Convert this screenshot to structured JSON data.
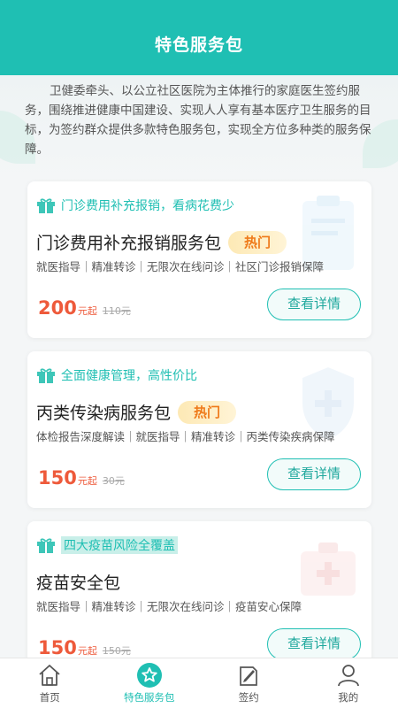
{
  "header": {
    "title": "特色服务包"
  },
  "intro": "卫健委牵头、以公立社区医院为主体推行的家庭医生签约服务，围绕推进健康中国建设、实现人人享有基本医疗卫生服务的目标，为签约群众提供多款特色服务包，实现全方位多种类的服务保障。",
  "packages": [
    {
      "tag": "门诊费用补充报销，看病花费少",
      "title": "门诊费用补充报销服务包",
      "hot": "热门",
      "services": "就医指导｜精准转诊｜无限次在线问诊｜社区门诊报销保障",
      "price": "200",
      "unit": "元起",
      "original": "110元",
      "button": "查看详情"
    },
    {
      "tag": "全面健康管理，高性价比",
      "title": "丙类传染病服务包",
      "hot": "热门",
      "services": "体检报告深度解读｜就医指导｜精准转诊｜丙类传染疾病保障",
      "price": "150",
      "unit": "元起",
      "original": "30元",
      "button": "查看详情"
    },
    {
      "tag": "四大疫苗风险全覆盖",
      "title": "疫苗安全包",
      "hot": "",
      "services": "就医指导｜精准转诊｜无限次在线问诊｜疫苗安心保障",
      "price": "150",
      "unit": "元起",
      "original": "150元",
      "button": "查看详情"
    }
  ],
  "tabs": [
    {
      "label": "首页",
      "icon": "home-icon"
    },
    {
      "label": "特色服务包",
      "icon": "star-badge-icon"
    },
    {
      "label": "签约",
      "icon": "sign-pen-icon"
    },
    {
      "label": "我的",
      "icon": "user-icon"
    }
  ],
  "colors": {
    "primary": "#1fbfb3",
    "price": "#ee5a3b",
    "hot": "#ef7a1a"
  }
}
